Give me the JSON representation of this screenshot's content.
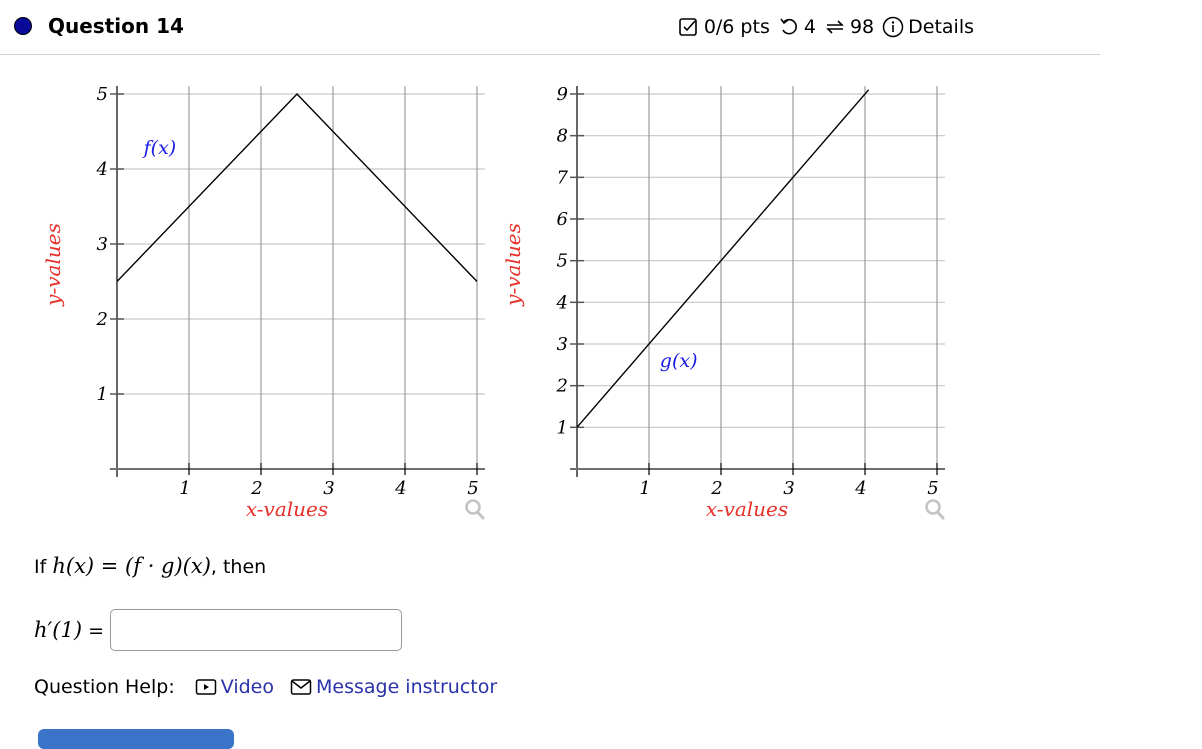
{
  "header": {
    "title": "Question 14",
    "score": "0/6 pts",
    "retries": "4",
    "attempts": "98",
    "details_label": "Details",
    "icons": [
      "checkbox-icon",
      "undo-icon",
      "repeat-icon",
      "info-icon"
    ]
  },
  "question": {
    "intro_prefix": "If ",
    "intro_math_h": "h",
    "intro_math_rest": "(x) = (f · g)(x)",
    "intro_suffix": ", then",
    "answer_label_math": "h′(1)",
    "answer_label_eq": " =",
    "answer_value": "",
    "answer_placeholder": ""
  },
  "help": {
    "label": "Question Help:",
    "video_label": "Video",
    "message_label": "Message instructor"
  },
  "colors": {
    "axis_label": "#e8302a",
    "function_label": "#1a1ae6",
    "link": "#2a33a8",
    "primary_button": "#3a73c8",
    "question_dot": "#0a0a9a"
  },
  "chart_data": [
    {
      "type": "line",
      "title": "",
      "function_label": "f(x)",
      "xlabel": "x-values",
      "ylabel": "y-values",
      "xlim": [
        0,
        5
      ],
      "ylim": [
        0,
        5
      ],
      "xticks": [
        1,
        2,
        3,
        4,
        5
      ],
      "yticks": [
        1,
        2,
        3,
        4,
        5
      ],
      "grid": true,
      "series": [
        {
          "name": "f(x)",
          "x": [
            0,
            2.5,
            5
          ],
          "y": [
            2.5,
            5,
            2.5
          ]
        }
      ]
    },
    {
      "type": "line",
      "title": "",
      "function_label": "g(x)",
      "xlabel": "x-values",
      "ylabel": "y-values",
      "xlim": [
        0,
        5
      ],
      "ylim": [
        0,
        9
      ],
      "xticks": [
        1,
        2,
        3,
        4,
        5
      ],
      "yticks": [
        1,
        2,
        3,
        4,
        5,
        6,
        7,
        8,
        9
      ],
      "grid": true,
      "series": [
        {
          "name": "g(x)",
          "x": [
            0,
            4.05
          ],
          "y": [
            1,
            9.1
          ]
        }
      ]
    }
  ]
}
